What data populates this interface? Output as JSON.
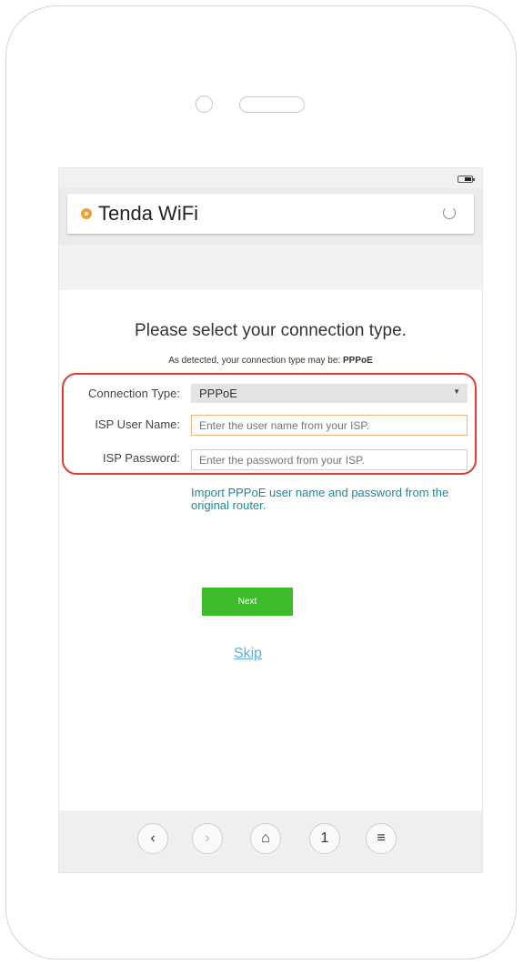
{
  "browser": {
    "site_title": "Tenda WiFi"
  },
  "page": {
    "heading": "Please select your connection type.",
    "detected_prefix": "As detected, your connection type may be: ",
    "detected_value": "PPPoE"
  },
  "form": {
    "connection_type_label": "Connection Type:",
    "connection_type_value": "PPPoE",
    "isp_user_label": "ISP User Name:",
    "isp_user_placeholder": "Enter the user name from your ISP.",
    "isp_password_label": "ISP Password:",
    "isp_password_placeholder": "Enter the password from your ISP."
  },
  "links": {
    "import_text": "Import PPPoE user name and password from the original router.",
    "skip": "Skip"
  },
  "buttons": {
    "next": "Next"
  },
  "navbar": {
    "page_indicator": "1"
  },
  "colors": {
    "highlight": "#e53935",
    "next_button": "#3ebb2a",
    "link": "#1a8a9a",
    "skip_link": "#5ab0e8",
    "logo": "#f0a030"
  }
}
